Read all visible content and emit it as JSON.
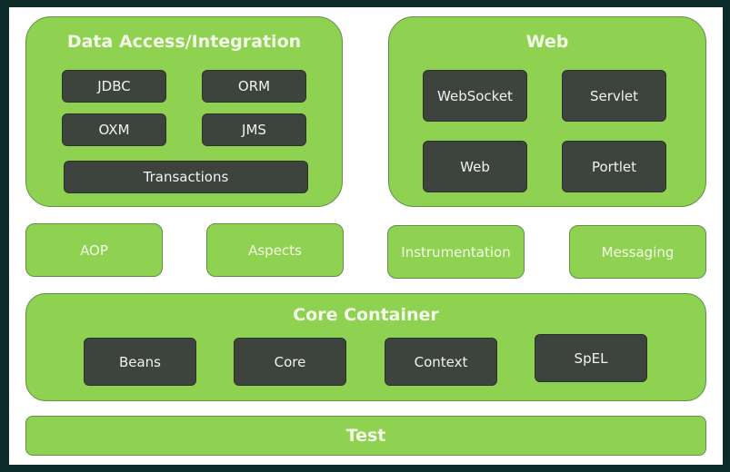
{
  "data_access": {
    "title": "Data Access/Integration",
    "items": [
      "JDBC",
      "ORM",
      "OXM",
      "JMS",
      "Transactions"
    ]
  },
  "web": {
    "title": "Web",
    "items": [
      "WebSocket",
      "Servlet",
      "Web",
      "Portlet"
    ]
  },
  "middle": [
    "AOP",
    "Aspects",
    "Instrumentation",
    "Messaging"
  ],
  "core": {
    "title": "Core Container",
    "items": [
      "Beans",
      "Core",
      "Context",
      "SpEL"
    ]
  },
  "test": {
    "title": "Test"
  },
  "colors": {
    "module_green": "#8fd150",
    "component_dark": "#3d433d"
  }
}
